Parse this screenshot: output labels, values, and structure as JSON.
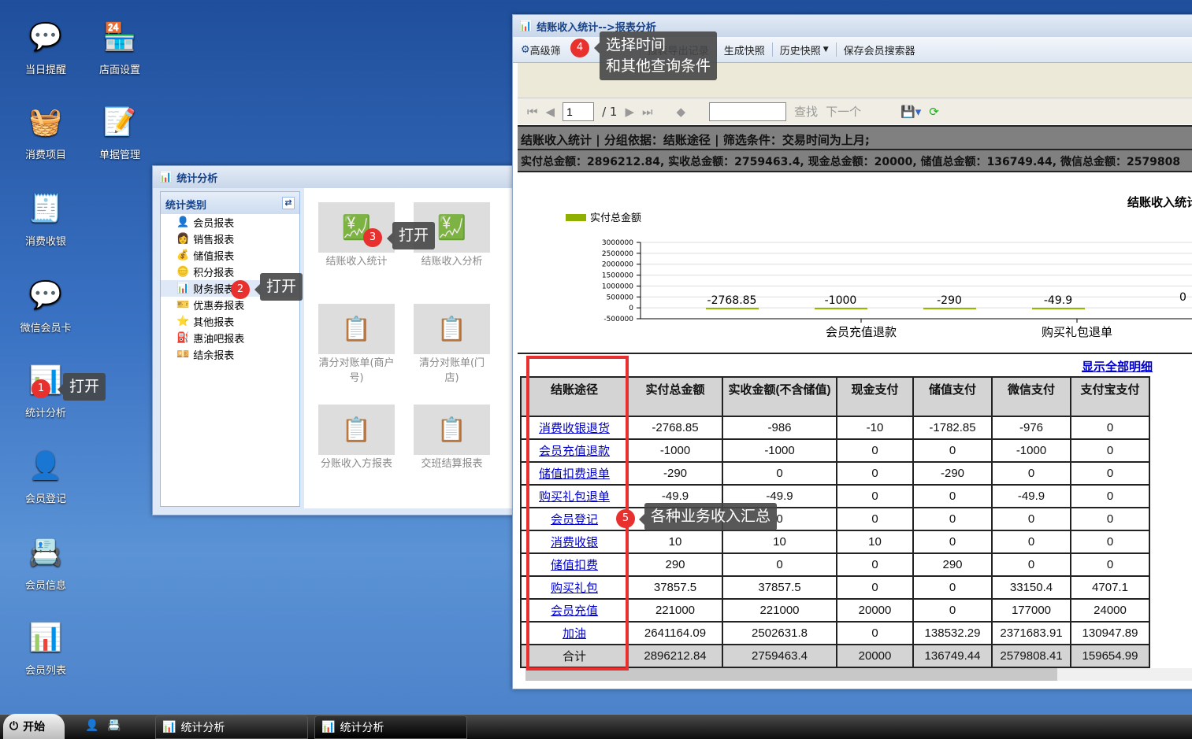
{
  "desktop": {
    "icons": [
      {
        "label": "当日提醒",
        "glyph": "💬"
      },
      {
        "label": "店面设置",
        "glyph": "🏪"
      },
      {
        "label": "消费项目",
        "glyph": "🧺"
      },
      {
        "label": "单据管理",
        "glyph": "📝"
      },
      {
        "label": "消费收银",
        "glyph": "🧾"
      },
      {
        "label": "微信会员卡",
        "glyph": "💬"
      },
      {
        "label": "统计分析",
        "glyph": "📊"
      },
      {
        "label": "会员登记",
        "glyph": "👤"
      },
      {
        "label": "会员信息",
        "glyph": "📇"
      },
      {
        "label": "会员列表",
        "glyph": "📊"
      }
    ]
  },
  "stats_window": {
    "title": "统计分析",
    "panel_title": "统计类别",
    "categories": [
      "会员报表",
      "销售报表",
      "储值报表",
      "积分报表",
      "财务报表",
      "优惠券报表",
      "其他报表",
      "惠油吧报表",
      "结余报表"
    ],
    "tiles": [
      "结账收入统计",
      "结账收入分析",
      "清分对账单(商户号)",
      "清分对账单(门店)",
      "分账收入方报表",
      "交班结算报表"
    ]
  },
  "report_window": {
    "title": "结账收入统计-->报表分析",
    "toolbar": [
      "高级筛",
      "报表导出记录",
      "生成快照",
      "历史快照",
      "保存会员搜索器"
    ],
    "nav": {
      "page": "1",
      "total": "/ 1",
      "find": "查找",
      "next": "下一个"
    },
    "info": "结账收入统计 | 分组依据：结账途径 | 筛选条件：交易时间为上月;",
    "summary": "实付总金额：2896212.84, 实收总金额：2759463.4, 现金总金额：20000, 储值总金额：136749.44, 微信总金额：2579808",
    "show_all": "显示全部明细"
  },
  "chart_data": {
    "type": "bar",
    "title": "结账收入统计",
    "legend": [
      "实付总金额"
    ],
    "legend_position": "top-left",
    "categories": [
      "消费收银退货",
      "会员充值退款",
      "储值扣费退单",
      "购买礼包退单",
      "会员登记"
    ],
    "visible_xlabels": [
      "会员充值退款",
      "购买礼包退单"
    ],
    "values": [
      -2768.85,
      -1000,
      -290,
      -49.9,
      0
    ],
    "yticks": [
      "3000000",
      "2500000",
      "2000000",
      "1500000",
      "1000000",
      "500000",
      "0",
      "-500000"
    ],
    "ylim": [
      -500000,
      3000000
    ],
    "grid": true,
    "color": "#8fb000"
  },
  "table": {
    "headers": [
      "结账途径",
      "实付总金额",
      "实收金额(不含储值)",
      "现金支付",
      "储值支付",
      "微信支付",
      "支付宝支付"
    ],
    "rows": [
      [
        "消费收银退货",
        "-2768.85",
        "-986",
        "-10",
        "-1782.85",
        "-976",
        "0"
      ],
      [
        "会员充值退款",
        "-1000",
        "-1000",
        "0",
        "0",
        "-1000",
        "0"
      ],
      [
        "储值扣费退单",
        "-290",
        "0",
        "0",
        "-290",
        "0",
        "0"
      ],
      [
        "购买礼包退单",
        "-49.9",
        "-49.9",
        "0",
        "0",
        "-49.9",
        "0"
      ],
      [
        "会员登记",
        "0",
        "0",
        "0",
        "0",
        "0",
        "0"
      ],
      [
        "消费收银",
        "10",
        "10",
        "10",
        "0",
        "0",
        "0"
      ],
      [
        "储值扣费",
        "290",
        "0",
        "0",
        "290",
        "0",
        "0"
      ],
      [
        "购买礼包",
        "37857.5",
        "37857.5",
        "0",
        "0",
        "33150.4",
        "4707.1"
      ],
      [
        "会员充值",
        "221000",
        "221000",
        "20000",
        "0",
        "177000",
        "24000"
      ],
      [
        "加油",
        "2641164.09",
        "2502631.8",
        "0",
        "138532.29",
        "2371683.91",
        "130947.89"
      ]
    ],
    "total": [
      "合计",
      "2896212.84",
      "2759463.4",
      "20000",
      "136749.44",
      "2579808.41",
      "159654.99"
    ]
  },
  "annotations": [
    {
      "n": "1",
      "text": "打开"
    },
    {
      "n": "2",
      "text": "打开"
    },
    {
      "n": "3",
      "text": "打开"
    },
    {
      "n": "4",
      "text": "选择时间\n和其他查询条件"
    },
    {
      "n": "5",
      "text": "各种业务收入汇总"
    }
  ],
  "taskbar": {
    "start": "开始",
    "tasks": [
      "统计分析",
      "统计分析"
    ]
  },
  "highlight_color": "#e83030"
}
